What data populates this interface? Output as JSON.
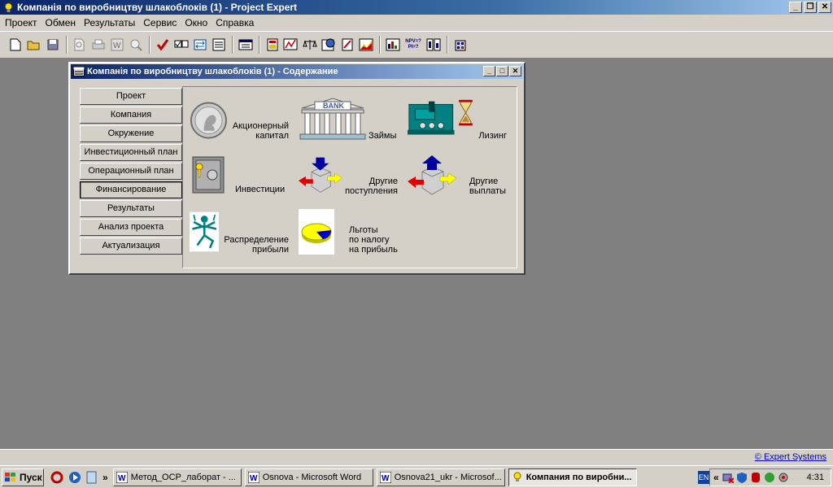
{
  "app": {
    "title": "Компанія по виробництву шлакоблоків (1) - Project Expert",
    "window_buttons": [
      "_",
      "❐",
      "✕"
    ]
  },
  "menu": [
    "Проект",
    "Обмен",
    "Результаты",
    "Сервис",
    "Окно",
    "Справка"
  ],
  "toolbar": {
    "npv_label": "NPV=?",
    "pi_label": "PI=?"
  },
  "child": {
    "title": "Компанія по виробництву шлакоблоків (1) - Содержание",
    "nav": [
      "Проект",
      "Компания",
      "Окружение",
      "Инвестиционный план",
      "Операционный план",
      "Финансирование",
      "Результаты",
      "Анализ проекта",
      "Актуализация"
    ],
    "active_nav": "Финансирование",
    "items": {
      "equity": [
        "Акционерный",
        "капитал"
      ],
      "loans": [
        "Займы"
      ],
      "bank_sign": "BANK",
      "leasing": [
        "Лизинг"
      ],
      "investments": [
        "Инвестиции"
      ],
      "other_income": [
        "Другие",
        "поступления"
      ],
      "other_payments": [
        "Другие",
        "выплаты"
      ],
      "profit_distribution": [
        "Распределение",
        "прибыли"
      ],
      "tax_benefits": [
        "Льготы",
        "по налогу",
        "на прибыль"
      ]
    }
  },
  "statusbar": {
    "link": "© Expert Systems"
  },
  "taskbar": {
    "start": "Пуск",
    "tasks": [
      "Метод_ОСР_лаборат - ...",
      "Osnova - Microsoft Word",
      "Osnova21_ukr - Microsof...",
      "Компания по виробни..."
    ],
    "lang": "EN",
    "clock": "4:31"
  }
}
